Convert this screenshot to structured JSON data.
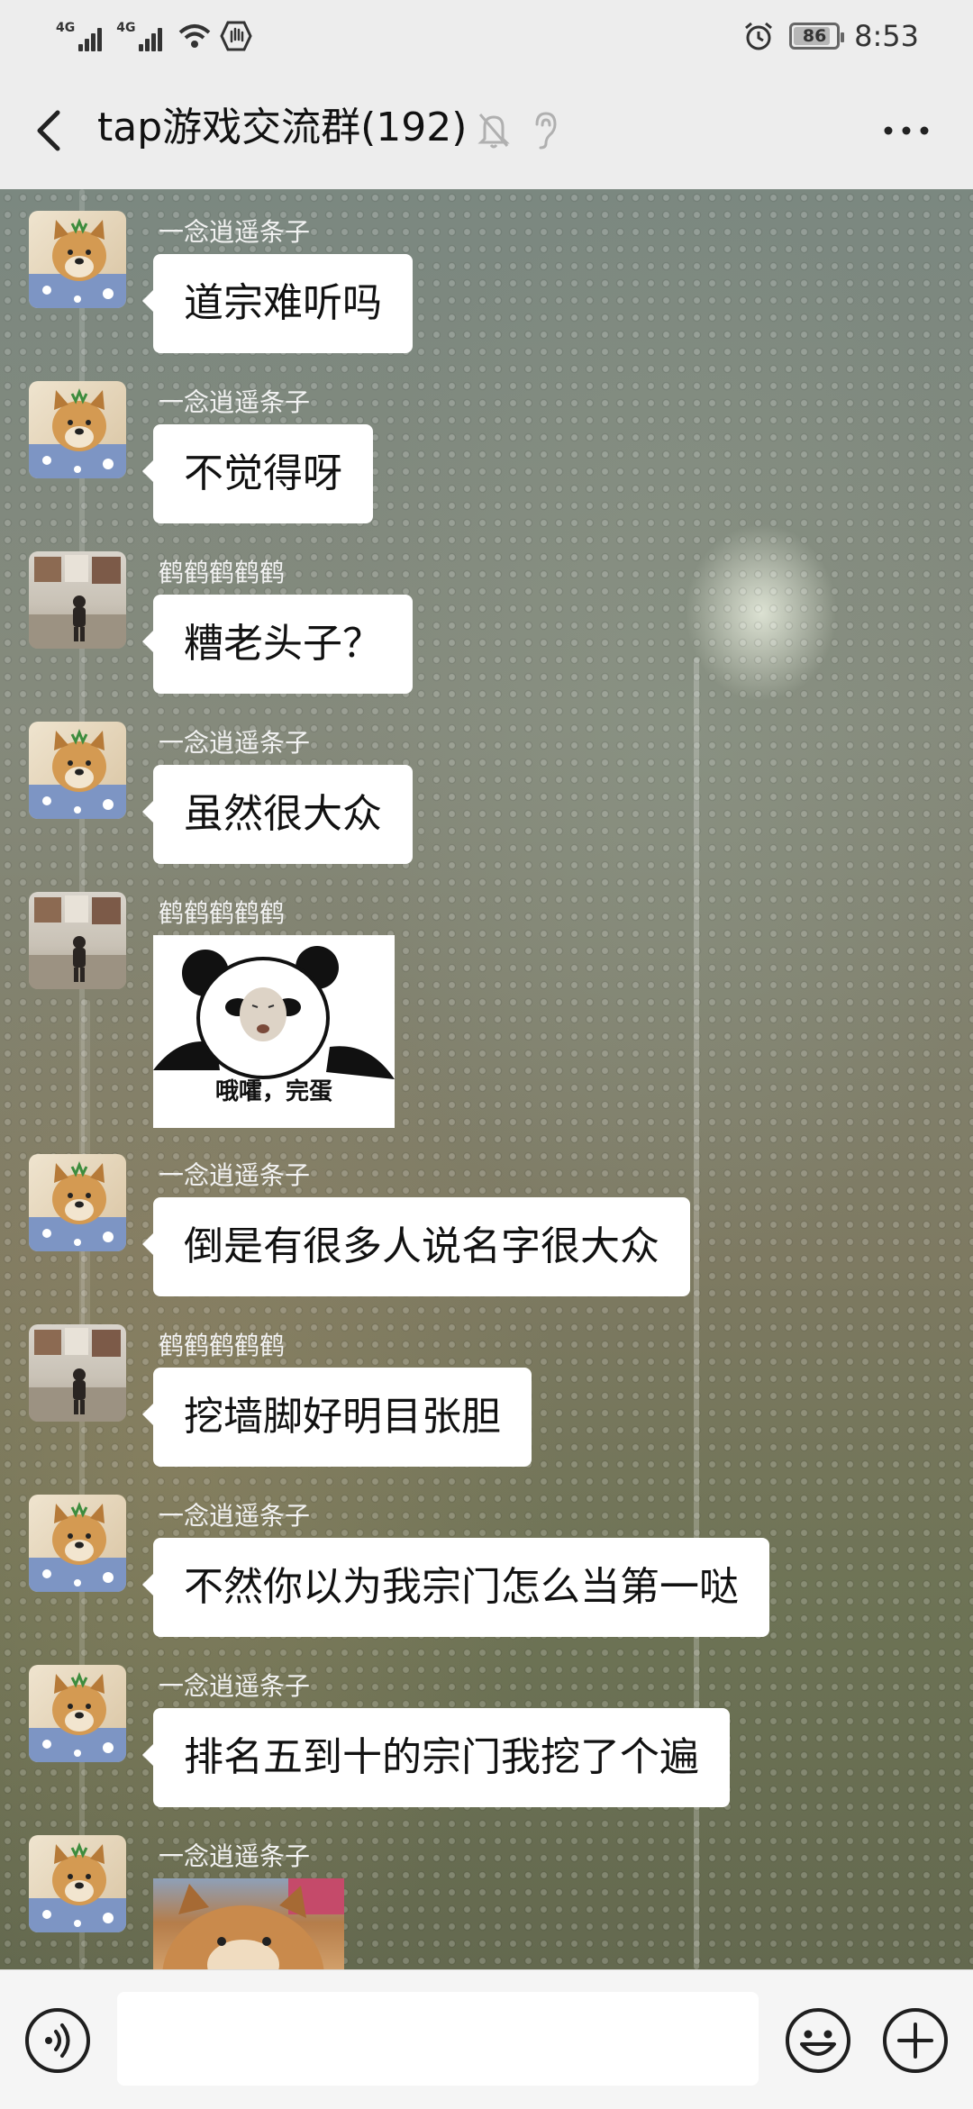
{
  "status_bar": {
    "network_1": "4G",
    "network_2": "4G",
    "battery_level": "86",
    "battery_fraction": 0.86,
    "time": "8:53"
  },
  "header": {
    "title": "tap游戏交流群(192)"
  },
  "messages": [
    {
      "sender": "一念逍遥条子",
      "text": "道宗难听吗"
    },
    {
      "sender": "一念逍遥条子",
      "text": "不觉得呀"
    },
    {
      "sender": "鹤鹤鹤鹤鹤",
      "text": "糟老头子？"
    },
    {
      "sender": "一念逍遥条子",
      "text": "虽然很大众"
    },
    {
      "sender": "鹤鹤鹤鹤鹤",
      "sticker_caption": "哦嚯，完蛋"
    },
    {
      "sender": "一念逍遥条子",
      "text": "倒是有很多人说名字很大众"
    },
    {
      "sender": "鹤鹤鹤鹤鹤",
      "text": "挖墙脚好明目张胆"
    },
    {
      "sender": "一念逍遥条子",
      "text": "不然你以为我宗门怎么当第一哒"
    },
    {
      "sender": "一念逍遥条子",
      "text": "排名五到十的宗门我挖了个遍"
    },
    {
      "sender": "一念逍遥条子"
    }
  ],
  "input": {
    "value": "",
    "placeholder": ""
  },
  "icons": {
    "back": "back-arrow-icon",
    "mute": "bell-muted-icon",
    "earpiece": "ear-icon",
    "more": "more-icon",
    "voice": "voice-icon",
    "emoji": "emoji-icon",
    "plus": "plus-icon",
    "alarm": "alarm-icon",
    "wifi": "wifi-icon"
  },
  "colors": {
    "bubble": "#ffffff",
    "sender_name": "#f2f2f2",
    "bar_background": "#ededed"
  }
}
